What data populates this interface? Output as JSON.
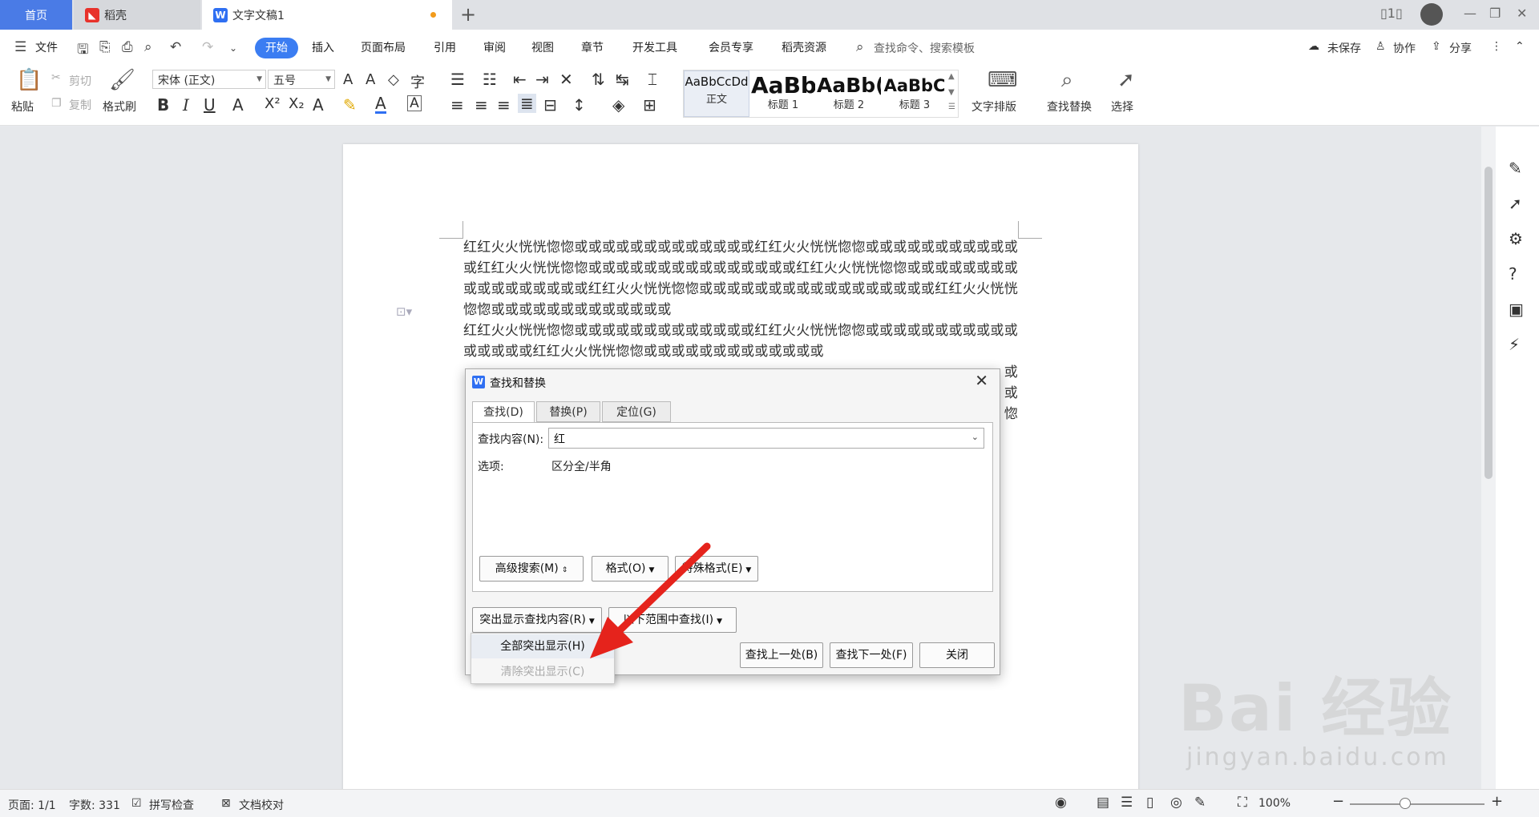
{
  "tabs": {
    "home": "首页",
    "daoke": "稻壳",
    "doc": "文字文稿1"
  },
  "menu": {
    "file": "文件",
    "items": [
      "开始",
      "插入",
      "页面布局",
      "引用",
      "审阅",
      "视图",
      "章节",
      "开发工具",
      "会员专享",
      "稻壳资源"
    ],
    "search_placeholder": "查找命令、搜索模板",
    "unsaved": "未保存",
    "collab": "协作",
    "share": "分享"
  },
  "ribbon": {
    "paste": "粘贴",
    "cut": "剪切",
    "copy": "复制",
    "format_painter": "格式刷",
    "font_name": "宋体 (正文)",
    "font_size": "五号",
    "styles": [
      {
        "sample": "AaBbCcDd",
        "name": "正文"
      },
      {
        "sample": "AaBb",
        "name": "标题 1"
      },
      {
        "sample": "AaBb(",
        "name": "标题 2"
      },
      {
        "sample": "AaBbC",
        "name": "标题 3"
      }
    ],
    "text_layout": "文字排版",
    "find_replace": "查找替换",
    "select": "选择"
  },
  "document": {
    "paragraphs": [
      "红红火火恍恍惚惚或或或或或或或或或或或或或红红火火恍恍惚惚或或或或或或或或或或或或红红火火恍恍惚惚或或或或或或或或或或或或或或或红红火火恍恍惚惚或或或或或或或或或或或或或或或或或红红火火恍恍惚惚或或或或或或或或或或或或或或或或或红红火火恍恍惚惚或或或或或或或或或或或或或",
      "红红火火恍恍惚惚或或或或或或或或或或或或或红红火火恍恍惚惚或或或或或或或或或或或或或或或或红红火火恍恍惚惚或或或或或或或或或或或或或",
      "或",
      "或",
      "惚"
    ]
  },
  "dialog": {
    "title": "查找和替换",
    "tabs": [
      "查找(D)",
      "替换(P)",
      "定位(G)"
    ],
    "find_label": "查找内容(N):",
    "find_value": "红",
    "options_label": "选项:",
    "options_value": "区分全/半角",
    "advanced": "高级搜索(M)",
    "format": "格式(O)",
    "special": "特殊格式(E)",
    "highlight": "突出显示查找内容(R)",
    "scope": "以下范围中查找(I)",
    "find_prev": "查找上一处(B)",
    "find_next": "查找下一处(F)",
    "close": "关闭",
    "menu_highlight_all": "全部突出显示(H)",
    "menu_clear": "清除突出显示(C)"
  },
  "status": {
    "page": "页面: 1/1",
    "words": "字数: 331",
    "spell": "拼写检查",
    "proof": "文档校对",
    "zoom": "100%"
  },
  "watermark": {
    "brand": "Bai 经验",
    "url": "jingyan.baidu.com"
  },
  "colors": {
    "accent": "#3b7df2",
    "arrow": "#e5231c",
    "unsaved_dot": "#f29b1b"
  }
}
